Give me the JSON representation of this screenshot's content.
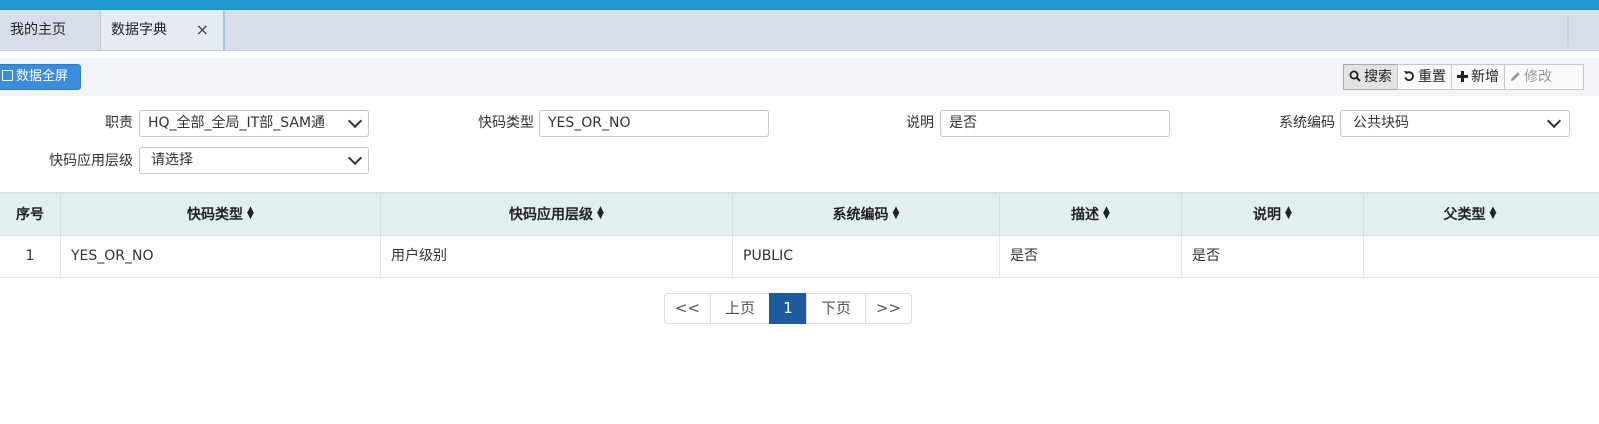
{
  "tabs": [
    {
      "label": "我的主页",
      "active": false
    },
    {
      "label": "数据字典",
      "active": true,
      "close": "×"
    }
  ],
  "toolbar": {
    "fullscreen_label": "数据全屏",
    "search_label": "搜索",
    "reset_label": "重置",
    "add_label": "新增",
    "edit_label": "修改"
  },
  "filters": {
    "duty": {
      "label": "职责",
      "value": "HQ_全部_全局_IT部_SAM通"
    },
    "code_type": {
      "label": "快码类型",
      "value": "YES_OR_NO"
    },
    "remark": {
      "label": "说明",
      "value": "是否"
    },
    "system_code": {
      "label": "系统编码",
      "value": "公共块码"
    },
    "level": {
      "label": "快码应用层级",
      "value": "请选择"
    }
  },
  "table": {
    "headers": [
      "序号",
      "快码类型",
      "快码应用层级",
      "系统编码",
      "描述",
      "说明",
      "父类型"
    ],
    "rows": [
      [
        "1",
        "YES_OR_NO",
        "用户级别",
        "PUBLIC",
        "是否",
        "是否",
        ""
      ]
    ]
  },
  "pagination": {
    "first": "<<",
    "prev": "上页",
    "current": "1",
    "next": "下页",
    "last": ">>"
  },
  "colors": {
    "topbar": "#2196c9",
    "primary_button": "#3c8dd9",
    "active_page": "#1d5b9e",
    "table_header": "#e1efee"
  },
  "icons": {
    "fullscreen": "square-icon",
    "search": "search-icon",
    "reset": "undo-icon",
    "add": "plus-icon",
    "edit": "pencil-icon",
    "sort": "sort-icon",
    "dropdown": "chevron-down-icon",
    "close": "close-icon"
  }
}
